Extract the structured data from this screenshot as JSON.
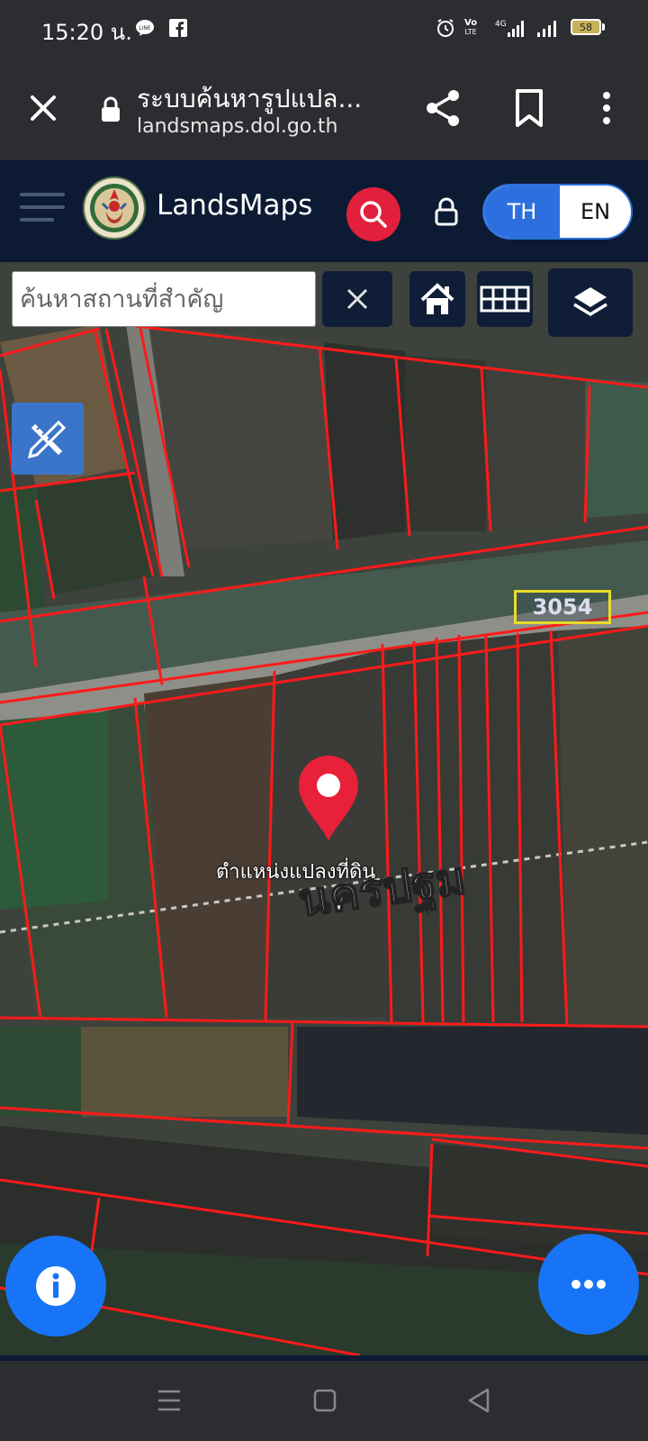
{
  "status_bar": {
    "time": "15:20 น.",
    "battery": "58",
    "network": "4G"
  },
  "browser": {
    "page_title": "ระบบค้นหารูปแปล...",
    "url": "landsmaps.dol.go.th",
    "icons": [
      "close-icon",
      "lock-icon",
      "share-icon",
      "bookmark-icon",
      "more-vert-icon"
    ]
  },
  "app_header": {
    "app_name": "LandsMaps",
    "lang_th": "TH",
    "lang_en": "EN",
    "active_language": "TH"
  },
  "map": {
    "search": {
      "placeholder": "ค้นหาสถานที่สำคัญ",
      "value": ""
    },
    "pin_label": "ตำแหน่งแปลงที่ดิน",
    "road_number": "3054",
    "place_label": "นครปฐม",
    "colors": {
      "parcel_lines": "#ff1a1a",
      "pin": "#e8203a",
      "fab": "#1774f6",
      "header": "#0c1a33"
    }
  }
}
